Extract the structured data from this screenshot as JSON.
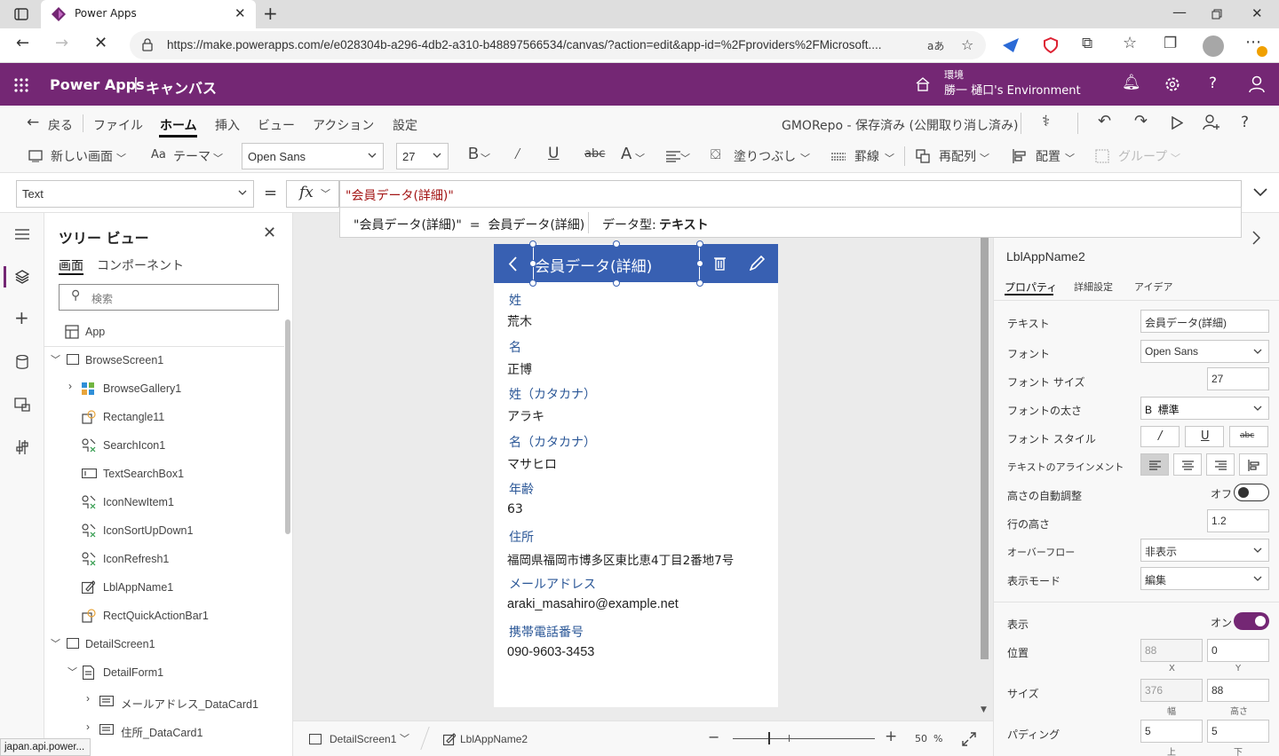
{
  "browser": {
    "tab_title": "Power Apps",
    "url": "https://make.powerapps.com/e/e028304b-a296-4db2-a310-b48897566534/canvas/?action=edit&app-id=%2Fproviders%2FMicrosoft....",
    "status_url": "japan.api.power..."
  },
  "app_header": {
    "title": "Power Apps",
    "separator": "|",
    "subtitle": "キャンバス",
    "env_label": "環境",
    "env_name": "勝一 樋口's Environment"
  },
  "command_bar": {
    "back": "戻る",
    "file": "ファイル",
    "home": "ホーム",
    "insert": "挿入",
    "view": "ビュー",
    "action": "アクション",
    "settings": "設定",
    "save_status": "GMORepo - 保存済み (公開取り消し済み)"
  },
  "ribbon": {
    "new_screen": "新しい画面",
    "theme": "テーマ",
    "font": "Open Sans",
    "font_size": "27",
    "fill": "塗りつぶし",
    "border": "罫線",
    "reorder": "再配列",
    "align": "配置",
    "group": "グループ"
  },
  "formula": {
    "property": "Text",
    "equals": "=",
    "fx": "fx",
    "value": "\"会員データ(詳細)\"",
    "hint_expr": "\"会員データ(詳細)\"  =  会員データ(詳細)",
    "hint_type_label": "データ型:",
    "hint_type_value": "テキスト"
  },
  "tree": {
    "title": "ツリー ビュー",
    "tabs": [
      "画面",
      "コンポーネント"
    ],
    "search_placeholder": "検索",
    "items": [
      {
        "label": "App"
      },
      {
        "label": "BrowseScreen1"
      },
      {
        "label": "BrowseGallery1"
      },
      {
        "label": "Rectangle11"
      },
      {
        "label": "SearchIcon1"
      },
      {
        "label": "TextSearchBox1"
      },
      {
        "label": "IconNewItem1"
      },
      {
        "label": "IconSortUpDown1"
      },
      {
        "label": "IconRefresh1"
      },
      {
        "label": "LblAppName1"
      },
      {
        "label": "RectQuickActionBar1"
      },
      {
        "label": "DetailScreen1"
      },
      {
        "label": "DetailForm1"
      },
      {
        "label": "メールアドレス_DataCard1"
      },
      {
        "label": "住所_DataCard1"
      }
    ]
  },
  "screen": {
    "header_title": "会員データ(詳細)",
    "fields": [
      {
        "label": "姓",
        "value": "荒木"
      },
      {
        "label": "名",
        "value": "正博"
      },
      {
        "label": "姓（カタカナ）",
        "value": "アラキ"
      },
      {
        "label": "名（カタカナ）",
        "value": "マサヒロ"
      },
      {
        "label": "年齢",
        "value": "63"
      },
      {
        "label": "住所",
        "value": "福岡県福岡市博多区東比恵4丁目2番地7号"
      },
      {
        "label": "メールアドレス",
        "value": "araki_masahiro@example.net"
      },
      {
        "label": "携帯電話番号",
        "value": "090-9603-3453"
      }
    ]
  },
  "status_bar": {
    "screen": "DetailScreen1",
    "control": "LblAppName2",
    "zoom": "50",
    "zoom_unit": "%"
  },
  "props": {
    "control_name": "LblAppName2",
    "tabs": [
      "プロパティ",
      "詳細設定",
      "アイデア"
    ],
    "text_label": "テキスト",
    "text_value": "会員データ(詳細)",
    "font_label": "フォント",
    "font_value": "Open Sans",
    "size_label": "フォント サイズ",
    "size_value": "27",
    "weight_label": "フォントの太さ",
    "weight_value": "B  標準",
    "style_label": "フォント スタイル",
    "align_label": "テキストのアラインメント",
    "autoheight_label": "高さの自動調整",
    "autoheight_value": "オフ",
    "lineheight_label": "行の高さ",
    "lineheight_value": "1.2",
    "overflow_label": "オーバーフロー",
    "overflow_value": "非表示",
    "mode_label": "表示モード",
    "mode_value": "編集",
    "visible_label": "表示",
    "visible_value": "オン",
    "position_label": "位置",
    "pos_x": "88",
    "pos_y": "0",
    "x_caption": "X",
    "y_caption": "Y",
    "size2_label": "サイズ",
    "width": "376",
    "height": "88",
    "w_caption": "幅",
    "h_caption": "高さ",
    "padding_label": "パディング",
    "pad_top": "5",
    "pad_bottom": "5",
    "top_caption": "上",
    "bottom_caption": "下"
  },
  "colors": {
    "brand": "#742774",
    "screen_header": "#3860b2",
    "toggle_on": "#742774"
  }
}
